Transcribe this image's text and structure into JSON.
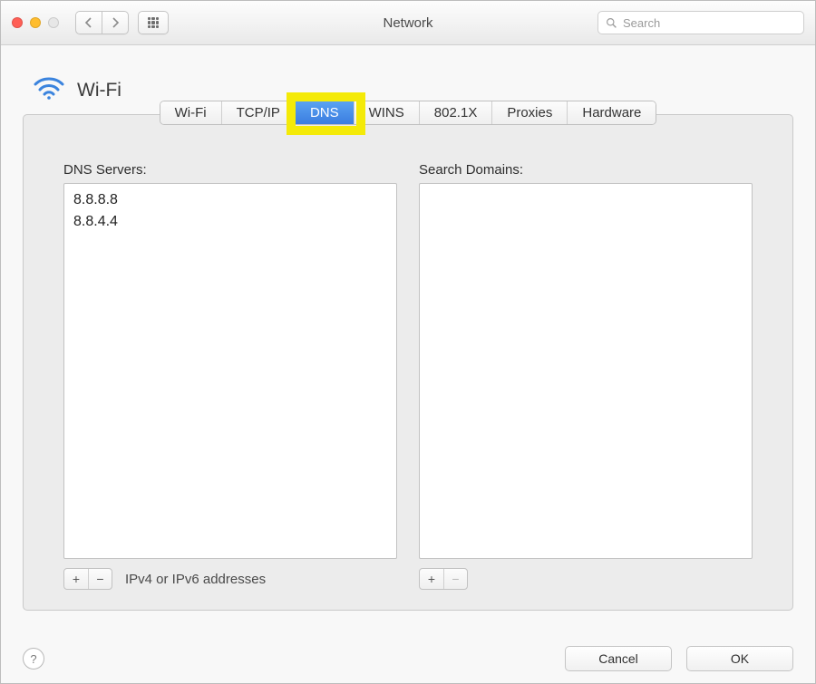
{
  "window": {
    "title": "Network"
  },
  "search": {
    "placeholder": "Search"
  },
  "header": {
    "interface_label": "Wi-Fi"
  },
  "tabs": {
    "items": [
      {
        "label": "Wi-Fi"
      },
      {
        "label": "TCP/IP"
      },
      {
        "label": "DNS"
      },
      {
        "label": "WINS"
      },
      {
        "label": "802.1X"
      },
      {
        "label": "Proxies"
      },
      {
        "label": "Hardware"
      }
    ],
    "active_index": 2
  },
  "dns": {
    "servers_label": "DNS Servers:",
    "servers_hint": "IPv4 or IPv6 addresses",
    "servers": [
      "8.8.8.8",
      "8.8.4.4"
    ],
    "search_domains_label": "Search Domains:",
    "search_domains": []
  },
  "buttons": {
    "help": "?",
    "cancel": "Cancel",
    "ok": "OK",
    "plus": "+",
    "minus": "−"
  }
}
